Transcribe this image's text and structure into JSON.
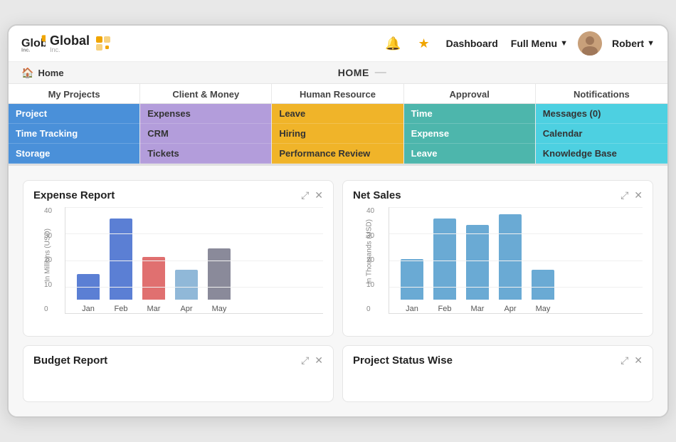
{
  "app": {
    "logo_text": "Global",
    "logo_sub": "Inc.",
    "nav_dashboard": "Dashboard",
    "nav_fullmenu": "Full Menu",
    "nav_user": "Robert",
    "breadcrumb_home": "Home",
    "breadcrumb_title": "HOME"
  },
  "menu": {
    "columns": [
      {
        "header": "My Projects",
        "items": [
          {
            "label": "Project",
            "color": "color-blue"
          },
          {
            "label": "Time Tracking",
            "color": "color-blue"
          },
          {
            "label": "Storage",
            "color": "color-blue"
          }
        ]
      },
      {
        "header": "Client & Money",
        "items": [
          {
            "label": "Expenses",
            "color": "color-purple"
          },
          {
            "label": "CRM",
            "color": "color-purple"
          },
          {
            "label": "Tickets",
            "color": "color-purple"
          }
        ]
      },
      {
        "header": "Human Resource",
        "items": [
          {
            "label": "Leave",
            "color": "color-orange"
          },
          {
            "label": "Hiring",
            "color": "color-orange"
          },
          {
            "label": "Performance Review",
            "color": "color-orange"
          }
        ]
      },
      {
        "header": "Approval",
        "items": [
          {
            "label": "Time",
            "color": "color-teal"
          },
          {
            "label": "Expense",
            "color": "color-teal"
          },
          {
            "label": "Leave",
            "color": "color-teal"
          }
        ]
      },
      {
        "header": "Notifications",
        "items": [
          {
            "label": "Messages (0)",
            "color": "color-cyan"
          },
          {
            "label": "Calendar",
            "color": "color-cyan"
          },
          {
            "label": "Knowledge Base",
            "color": "color-cyan"
          }
        ]
      }
    ]
  },
  "widgets": [
    {
      "id": "expense-report",
      "title": "Expense Report",
      "y_label": "In Millions (USD)",
      "bars": [
        {
          "label": "Jan",
          "value": 12,
          "color": "#5B7FD4"
        },
        {
          "label": "Feb",
          "value": 38,
          "color": "#5B7FD4"
        },
        {
          "label": "Mar",
          "value": 20,
          "color": "#E07070"
        },
        {
          "label": "Apr",
          "value": 14,
          "color": "#90B8D8"
        },
        {
          "label": "May",
          "value": 24,
          "color": "#8A8A9A"
        }
      ],
      "y_max": 40,
      "y_ticks": [
        "40",
        "30",
        "20",
        "10",
        "0"
      ]
    },
    {
      "id": "net-sales",
      "title": "Net Sales",
      "y_label": "In Thousands (USD)",
      "bars": [
        {
          "label": "Jan",
          "value": 19,
          "color": "#6AAAD4"
        },
        {
          "label": "Feb",
          "value": 38,
          "color": "#6AAAD4"
        },
        {
          "label": "Mar",
          "value": 35,
          "color": "#6AAAD4"
        },
        {
          "label": "Apr",
          "value": 40,
          "color": "#6AAAD4"
        },
        {
          "label": "May",
          "value": 14,
          "color": "#6AAAD4"
        }
      ],
      "y_max": 40,
      "y_ticks": [
        "40",
        "30",
        "20",
        "10",
        "0"
      ]
    },
    {
      "id": "budget-report",
      "title": "Budget Report"
    },
    {
      "id": "project-status",
      "title": "Project Status Wise"
    }
  ],
  "icons": {
    "bell": "🔔",
    "star": "★",
    "dropdown": "▼",
    "expand": "⤢",
    "close": "✕",
    "home": "🏠",
    "cursor": "↖"
  }
}
